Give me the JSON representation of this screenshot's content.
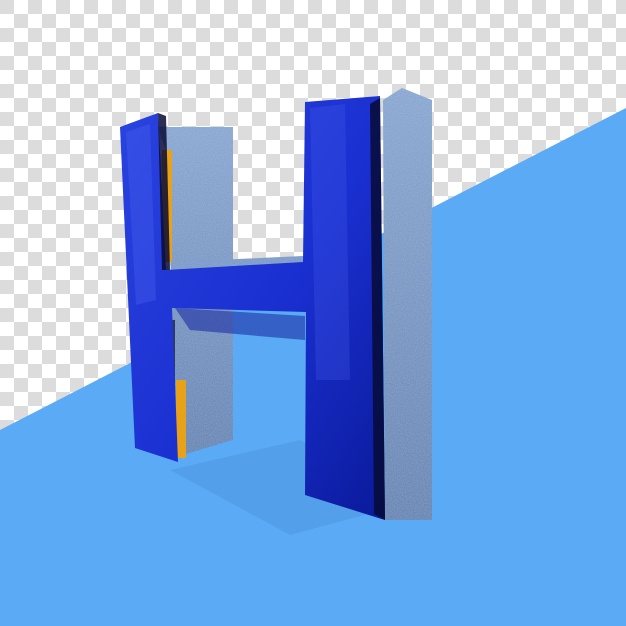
{
  "image": {
    "subject": "letter-h-3d",
    "letter": "H",
    "colors": {
      "checker_light": "#ffffff",
      "checker_dark": "#dcdcdc",
      "backdrop_blue": "#5aaaf6",
      "letter_front": "#1a2fd0",
      "letter_front_dark": "#0a1a9a",
      "letter_side": "#6b8fc0",
      "letter_side_dark": "#4a6a99",
      "accent_orange": "#e8a21a",
      "shadow": "#3c6fb5"
    }
  }
}
